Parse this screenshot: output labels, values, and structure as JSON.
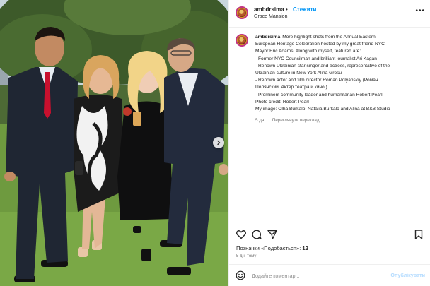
{
  "post": {
    "username": "ambdrsima",
    "separator": "•",
    "follow_label": "Стежити",
    "location": "Grace Mansion",
    "more_icon": "more-horizontal-icon"
  },
  "caption": {
    "username": "ambdrsima",
    "lines": [
      "More highlight shots from the Annual Eastern",
      "European Heritage Celebration hosted by my great friend NYC",
      "Mayor Eric Adams. Along with myself, featured are:",
      "- Former NYC Councilman and brilliant journalist Ari Kagan",
      "- Renown Ukrainian star singer and actress, representative of the",
      "Ukrainian culture in New York Alina Grosu",
      "- Renown actor and film director Roman Polyanskiy (Роман",
      "Полянский. Актер театра и кино.)",
      "- Prominent community leader and humanitarian Robert Pearl",
      "Photo credit: Robert Pearl",
      "My image: Olha Burkalo, Natalia Burkalo and Alina at B&B Studio"
    ],
    "age": "5 дн.",
    "translate_label": "Переглянути переклад"
  },
  "actions": {
    "icons": [
      "heart-icon",
      "comment-icon",
      "share-icon",
      "bookmark-icon"
    ]
  },
  "likes": {
    "label": "Позначки «Подобається»: ",
    "count": "12"
  },
  "time_ago": "5 дн. тому",
  "comment": {
    "placeholder": "Додайте коментар...",
    "publish_label": "Опублікувати"
  },
  "colors": {
    "accent": "#0095f6",
    "text": "#262626",
    "muted": "#737373",
    "publish_disabled": "#b3dbff"
  }
}
